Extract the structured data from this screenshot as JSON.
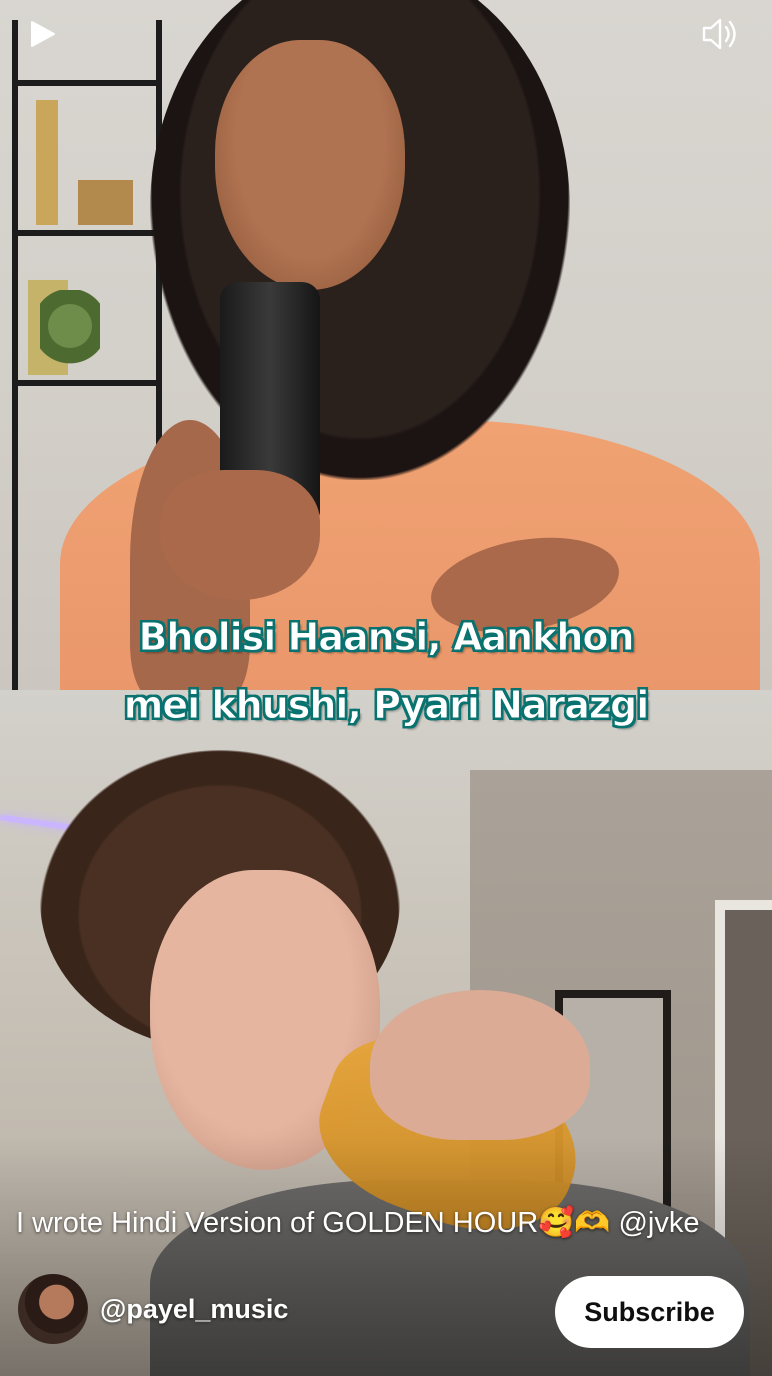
{
  "video": {
    "caption_line_1": "Bholisi Haansi, Aankhon",
    "caption_line_2": "mei khushi, Pyari Narazgi",
    "title": "I wrote Hindi Version of GOLDEN HOUR🥰🫶 @jvke"
  },
  "controls": {
    "play_icon": "play-icon",
    "volume_icon": "volume-icon"
  },
  "channel": {
    "name": "@payel_music",
    "subscribe_label": "Subscribe"
  },
  "colors": {
    "caption_text": "#ffffff",
    "caption_outline": "#0a7370",
    "subscribe_bg": "#ffffff",
    "subscribe_text": "#0f0f0f",
    "shirt_top": "#f0a272"
  }
}
